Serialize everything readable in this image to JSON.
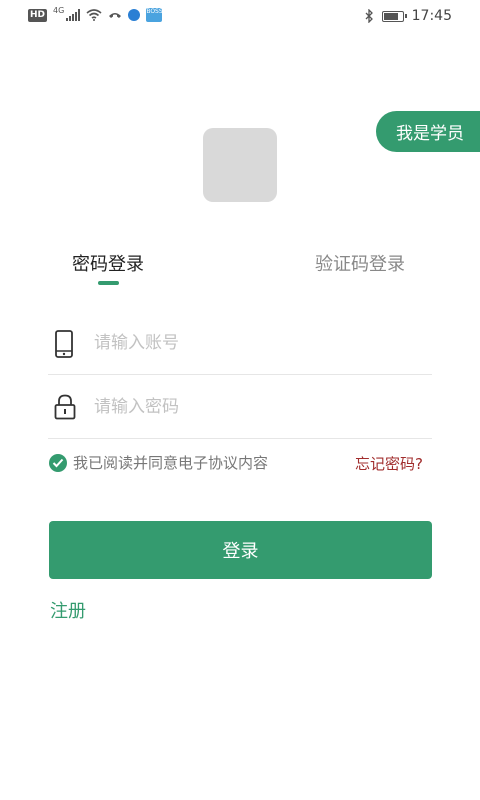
{
  "status_bar": {
    "hd_label": "HD",
    "network_label": "4G",
    "app_badge_text": "BOSS",
    "time": "17:45",
    "icons": [
      "hd-icon",
      "signal-icon",
      "wifi-icon",
      "call-icon",
      "app-icon",
      "bluetooth-icon",
      "battery-icon"
    ]
  },
  "role_switch": {
    "label": "我是学员"
  },
  "tabs": [
    {
      "label": "密码登录",
      "active": true
    },
    {
      "label": "验证码登录",
      "active": false
    }
  ],
  "form": {
    "account": {
      "placeholder": "请输入账号",
      "value": "",
      "icon": "phone-icon"
    },
    "password": {
      "placeholder": "请输入密码",
      "value": "",
      "icon": "lock-icon"
    },
    "agreement": {
      "label": "我已阅读并同意电子协议内容",
      "checked": true
    },
    "forgot_label": "忘记密码?",
    "login_label": "登录",
    "register_label": "注册"
  },
  "colors": {
    "accent": "#349b6f",
    "forgot": "#a12d2d",
    "placeholder": "#c2c2c2",
    "logo_placeholder": "#d9d9d9"
  }
}
